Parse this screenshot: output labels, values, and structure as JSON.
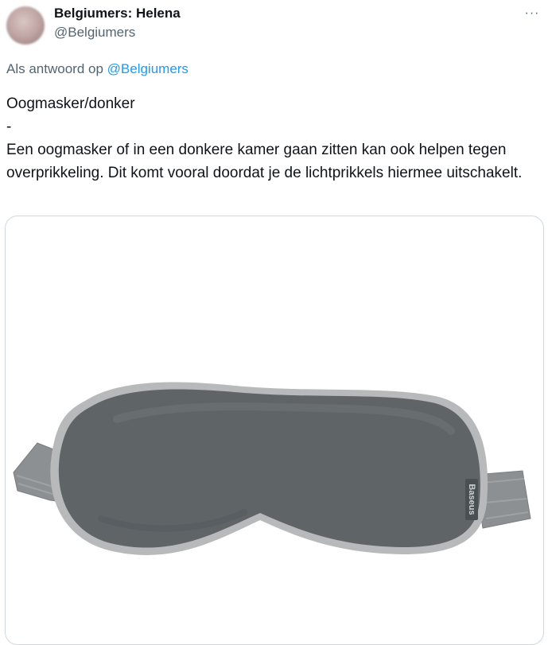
{
  "tweet": {
    "author_name": "Belgiumers: Helena",
    "author_handle": "@Belgiumers",
    "reply_prefix": "Als antwoord op",
    "reply_to": "@Belgiumers",
    "text_line1": "Oogmasker/donker",
    "text_line2": "-",
    "text_line3": "Een oogmasker of in een donkere kamer gaan zitten kan ook helpen tegen overprikkeling. Dit komt vooral doordat je de lichtprikkels hiermee uitschakelt.",
    "more_icon": "more-horizontal-icon",
    "more_symbol": "···"
  },
  "media": {
    "brand_label": "Baseus",
    "mask_color": "#5f6467",
    "trim_color": "#b7b9ba",
    "strap_color": "#8d9092"
  }
}
